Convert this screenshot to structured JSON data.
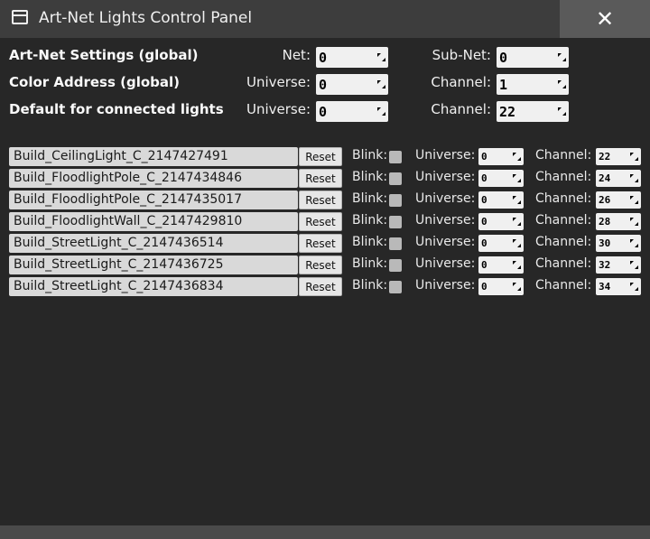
{
  "window": {
    "title": "Art-Net Lights Control Panel",
    "close_glyph": "✕"
  },
  "settings": {
    "art_net": {
      "label": "Art-Net Settings (global)",
      "net_label": "Net:",
      "net": "0",
      "subnet_label": "Sub-Net:",
      "subnet": "0"
    },
    "color_address": {
      "label": "Color Address (global)",
      "universe_label": "Universe:",
      "universe": "0",
      "channel_label": "Channel:",
      "channel": "1"
    },
    "default": {
      "label": "Default for connected lights",
      "universe_label": "Universe:",
      "universe": "0",
      "channel_label": "Channel:",
      "channel": "22"
    }
  },
  "lights_labels": {
    "reset": "Reset",
    "blink": "Blink:",
    "universe": "Universe:",
    "channel": "Channel:"
  },
  "lights": [
    {
      "name": "Build_CeilingLight_C_2147427491",
      "universe": "0",
      "channel": "22"
    },
    {
      "name": "Build_FloodlightPole_C_2147434846",
      "universe": "0",
      "channel": "24"
    },
    {
      "name": "Build_FloodlightPole_C_2147435017",
      "universe": "0",
      "channel": "26"
    },
    {
      "name": "Build_FloodlightWall_C_2147429810",
      "universe": "0",
      "channel": "28"
    },
    {
      "name": "Build_StreetLight_C_2147436514",
      "universe": "0",
      "channel": "30"
    },
    {
      "name": "Build_StreetLight_C_2147436725",
      "universe": "0",
      "channel": "32"
    },
    {
      "name": "Build_StreetLight_C_2147436834",
      "universe": "0",
      "channel": "34"
    }
  ]
}
